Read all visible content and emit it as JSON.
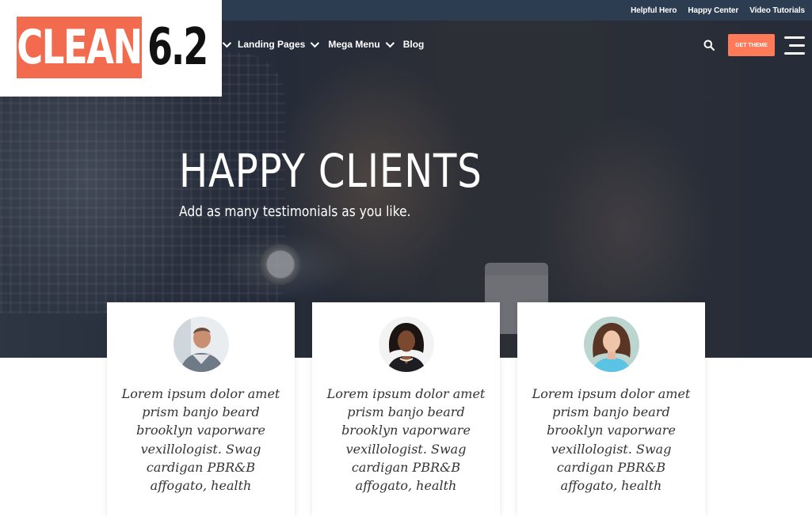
{
  "topbar": {
    "links": [
      "Helpful Hero",
      "Happy Center",
      "Video Tutorials"
    ]
  },
  "logo": {
    "brand": "CLEAN",
    "version": "6.2"
  },
  "nav": {
    "items": [
      {
        "label": "Landing Pages"
      },
      {
        "label": "Mega Menu"
      },
      {
        "label": "Blog"
      }
    ],
    "cta_label": "GET THEME"
  },
  "hero": {
    "title": "HAPPY CLIENTS",
    "subtitle": "Add as many testimonials as you like."
  },
  "testimonials": [
    {
      "quote": "Lorem ipsum dolor amet prism banjo beard brooklyn vaporware vexillologist. Swag cardigan PBR&B affogato, health"
    },
    {
      "quote": "Lorem ipsum dolor amet prism banjo beard brooklyn vaporware vexillologist. Swag cardigan PBR&B affogato, health"
    },
    {
      "quote": "Lorem ipsum dolor amet prism banjo beard brooklyn vaporware vexillologist. Swag cardigan PBR&B affogato, health"
    }
  ],
  "colors": {
    "accent": "#ff7a59",
    "logo_orange": "#f26b4f",
    "topbar": "#2d3d51"
  }
}
